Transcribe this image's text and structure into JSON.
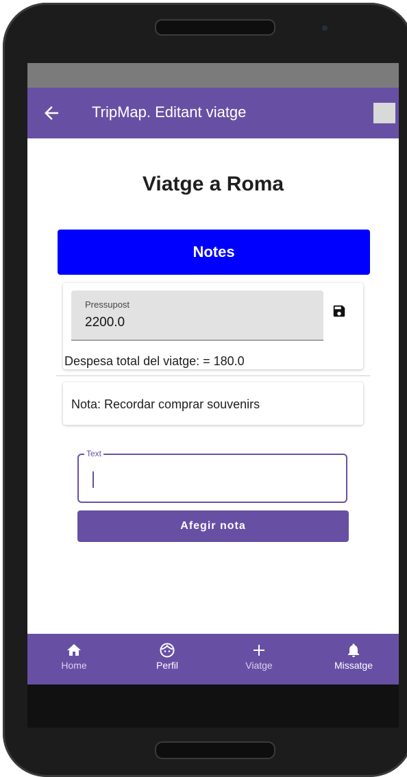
{
  "appbar": {
    "title": "TripMap. Editant viatge"
  },
  "trip": {
    "title": "Viatge a Roma"
  },
  "notes_button": {
    "label": "Notes"
  },
  "budget": {
    "label": "Pressupost",
    "value": "2200.0"
  },
  "total": {
    "text": "Despesa total del viatge: = 180.0"
  },
  "note": {
    "text": "Nota: Recordar comprar souvenirs"
  },
  "text_field": {
    "label": "Text",
    "value": ""
  },
  "add_button": {
    "label": "Afegir nota"
  },
  "bottom_nav": {
    "items": [
      {
        "label": "Home",
        "icon": "home-icon"
      },
      {
        "label": "Perfil",
        "icon": "face-icon"
      },
      {
        "label": "Viatge",
        "icon": "plus-icon"
      },
      {
        "label": "Missatge",
        "icon": "bell-icon"
      }
    ]
  },
  "colors": {
    "primary": "#6750a4",
    "notes_button": "#0000ff",
    "status_bar": "#7b7b7b"
  }
}
